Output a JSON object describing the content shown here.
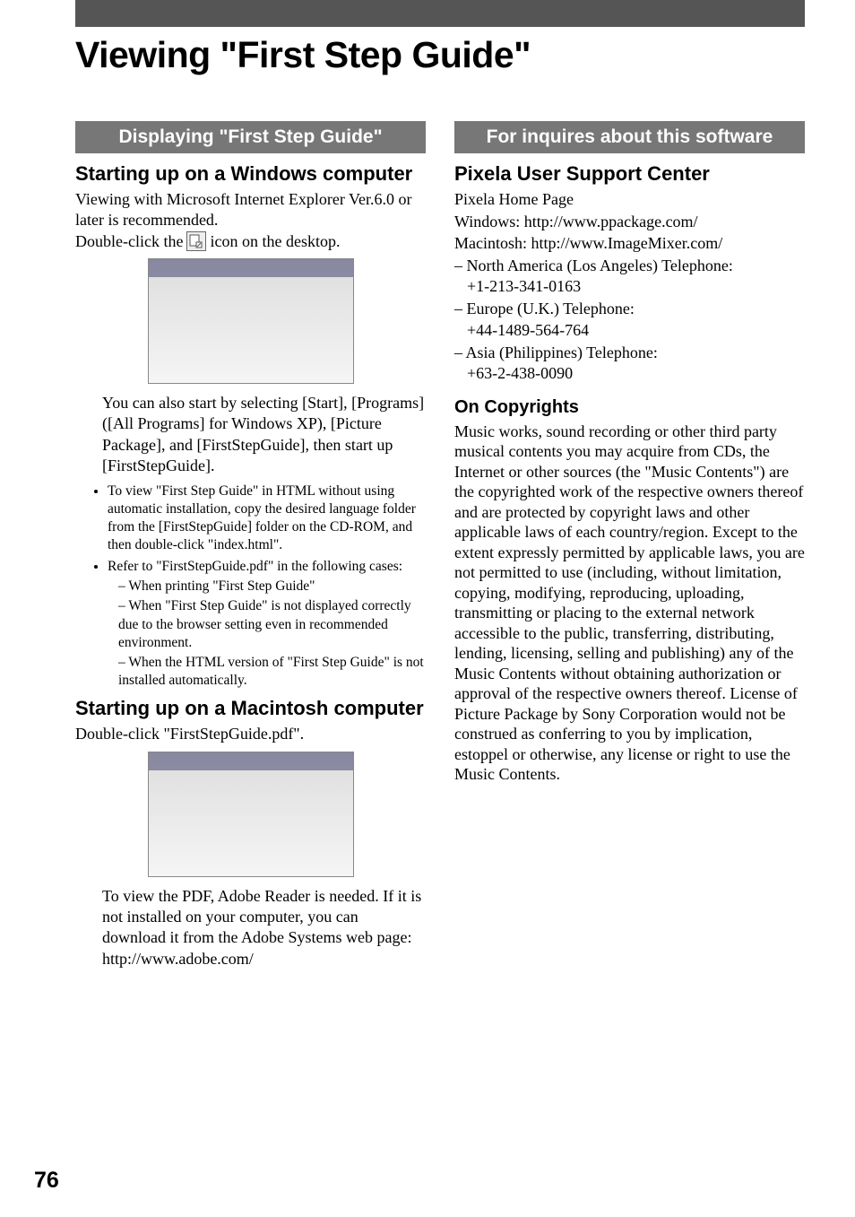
{
  "page_title": "Viewing \"First Step Guide\"",
  "left": {
    "banner": "Displaying \"First Step Guide\"",
    "h_win": "Starting up on a Windows computer",
    "p_win1": "Viewing with Microsoft Internet Explorer Ver.6.0 or later is recommended.",
    "p_win2a": "Double-click the",
    "p_win2b": "icon on the desktop.",
    "p_win3": "You can also start by selecting [Start], [Programs] ([All Programs] for Windows XP), [Picture Package], and [FirstStepGuide], then start up [FirstStepGuide].",
    "bul1": "To view \"First Step Guide\" in HTML without using automatic installation, copy the desired language folder from the [FirstStepGuide] folder on the CD-ROM, and then double-click \"index.html\".",
    "bul2": "Refer to \"FirstStepGuide.pdf\" in the following cases:",
    "dash1": "When printing \"First Step Guide\"",
    "dash2": "When \"First Step Guide\" is not displayed correctly due to the browser setting even in recommended environment.",
    "dash3": "When the HTML version of \"First Step Guide\" is not installed automatically.",
    "h_mac": "Starting up on a Macintosh computer",
    "p_mac1": "Double-click \"FirstStepGuide.pdf\".",
    "p_mac2": "To view the PDF, Adobe Reader is needed. If it is not installed on your computer, you can download it from the Adobe Systems web page:",
    "p_mac3": "http://www.adobe.com/"
  },
  "right": {
    "banner": "For inquires about this software",
    "h_px": "Pixela User Support Center",
    "px_home": "Pixela Home Page",
    "px_win": "Windows: http://www.ppackage.com/",
    "px_mac": "Macintosh: http://www.ImageMixer.com/",
    "regions": [
      {
        "label": "North America (Los Angeles) Telephone:",
        "num": "+1-213-341-0163"
      },
      {
        "label": "Europe (U.K.) Telephone:",
        "num": "+44-1489-564-764"
      },
      {
        "label": "Asia (Philippines) Telephone:",
        "num": "+63-2-438-0090"
      }
    ],
    "h_copy": "On Copyrights",
    "copy_body": "Music works, sound recording or other third party musical contents you may acquire from CDs, the Internet or other sources (the \"Music Contents\") are the copyrighted work of the respective owners thereof and are protected by copyright laws and other applicable laws of each country/region. Except to the extent expressly permitted by applicable laws, you are not permitted to use (including, without limitation, copying, modifying, reproducing, uploading, transmitting or placing to the external network accessible to the public, transferring, distributing, lending, licensing, selling and publishing) any of the Music Contents without obtaining authorization or approval of the respective owners thereof. License of Picture Package by Sony Corporation would not be construed as conferring to you by implication, estoppel or otherwise, any license or right to use the Music Contents."
  },
  "page_number": "76",
  "icon_names": {
    "desktop": "first-step-guide-shortcut-icon",
    "doc": "document-icon"
  }
}
